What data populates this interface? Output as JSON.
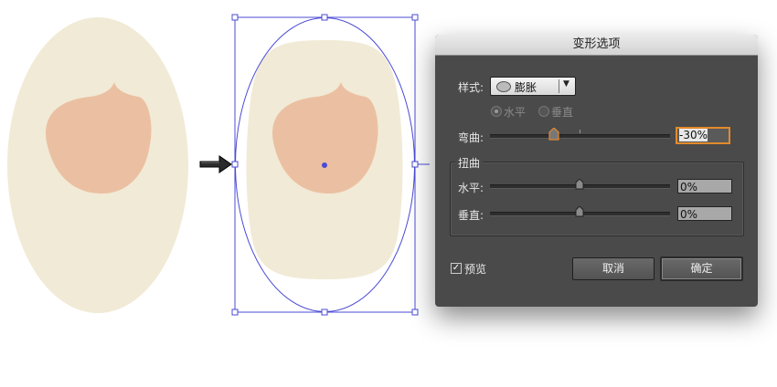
{
  "dialog": {
    "title": "变形选项",
    "style_label": "样式:",
    "style_value": "膨胀",
    "orientation": {
      "horizontal": "水平",
      "vertical": "垂直",
      "selected": "horizontal"
    },
    "bend": {
      "label": "弯曲:",
      "value": "-30%",
      "fraction": 0.35
    },
    "distortion": {
      "title": "扭曲",
      "horizontal": {
        "label": "水平:",
        "value": "0%",
        "fraction": 0.5
      },
      "vertical": {
        "label": "垂直:",
        "value": "0%",
        "fraction": 0.5
      }
    },
    "preview": {
      "label": "预览",
      "checked": true
    },
    "cancel_label": "取消",
    "ok_label": "确定"
  },
  "colors": {
    "shape_fill": "#f1ead6",
    "face_fill": "#ebc0a2",
    "selection": "#4b4bd6",
    "accent": "#e38a2c"
  }
}
